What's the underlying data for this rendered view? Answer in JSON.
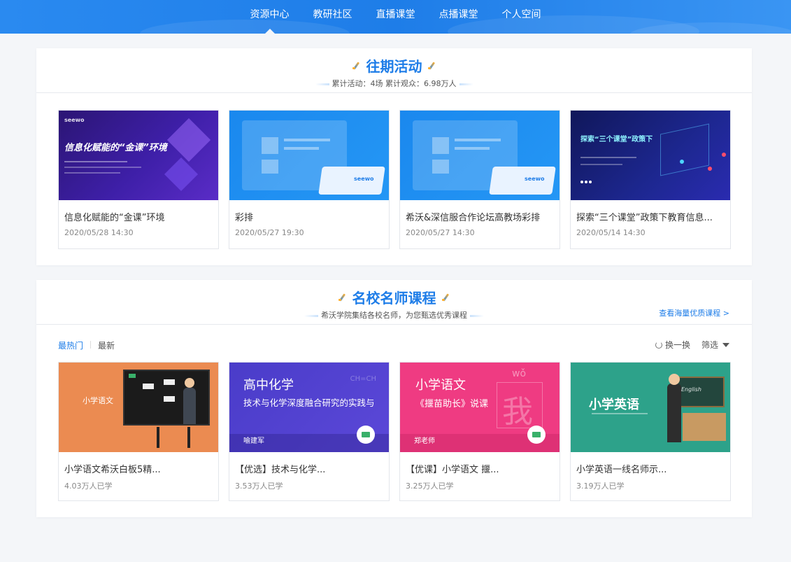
{
  "nav": {
    "items": [
      {
        "label": "资源中心",
        "active": true
      },
      {
        "label": "教研社区",
        "active": false
      },
      {
        "label": "直播课堂",
        "active": false
      },
      {
        "label": "点播课堂",
        "active": false
      },
      {
        "label": "个人空间",
        "active": false
      }
    ]
  },
  "past_activities": {
    "title": "往期活动",
    "subtitle": "累计活动：4场    累计观众：6.98万人",
    "cards": [
      {
        "title": "信息化赋能的“金课”环境",
        "time": "2020/05/28 14:30",
        "thumb_text": "信息化赋能的“金课”环境",
        "thumb_brand": "seewo"
      },
      {
        "title": "彩排",
        "time": "2020/05/27 19:30",
        "thumb_brand": "seewo"
      },
      {
        "title": "希沃&深信服合作论坛高教场彩排",
        "time": "2020/05/27 14:30",
        "thumb_brand": "seewo"
      },
      {
        "title": "探索“三个课堂”政策下教育信息...",
        "time": "2020/05/14 14:30",
        "thumb_text": "探索“三个课堂”政策下"
      }
    ]
  },
  "courses": {
    "title": "名校名师课程",
    "subtitle": "希沃学院集结各校名师，为您甄选优秀课程",
    "more_link": "查看海量优质课程 >",
    "tabs": {
      "hot": "最热门",
      "newest": "最新"
    },
    "tools": {
      "refresh": "换一换",
      "filter": "筛选"
    },
    "cards": [
      {
        "title": "小学语文希沃白板5精...",
        "learners": "4.03万人已学",
        "thumb_text": "小学语文"
      },
      {
        "title": "【优选】技术与化学...",
        "learners": "3.53万人已学",
        "thumb_title": "高中化学",
        "thumb_sub": "技术与化学深度融合研究的实践与",
        "thumb_teacher": "喻建军",
        "thumb_deco": "CH=CH"
      },
      {
        "title": "【优课】小学语文 揠...",
        "learners": "3.25万人已学",
        "thumb_title": "小学语文",
        "thumb_sub": "《揠苗助长》说课",
        "thumb_teacher": "郑老师",
        "thumb_big": "我",
        "thumb_pinyin": "wǒ"
      },
      {
        "title": "小学英语一线名师示...",
        "learners": "3.19万人已学",
        "thumb_title": "小学英语",
        "thumb_board": "English"
      }
    ]
  }
}
